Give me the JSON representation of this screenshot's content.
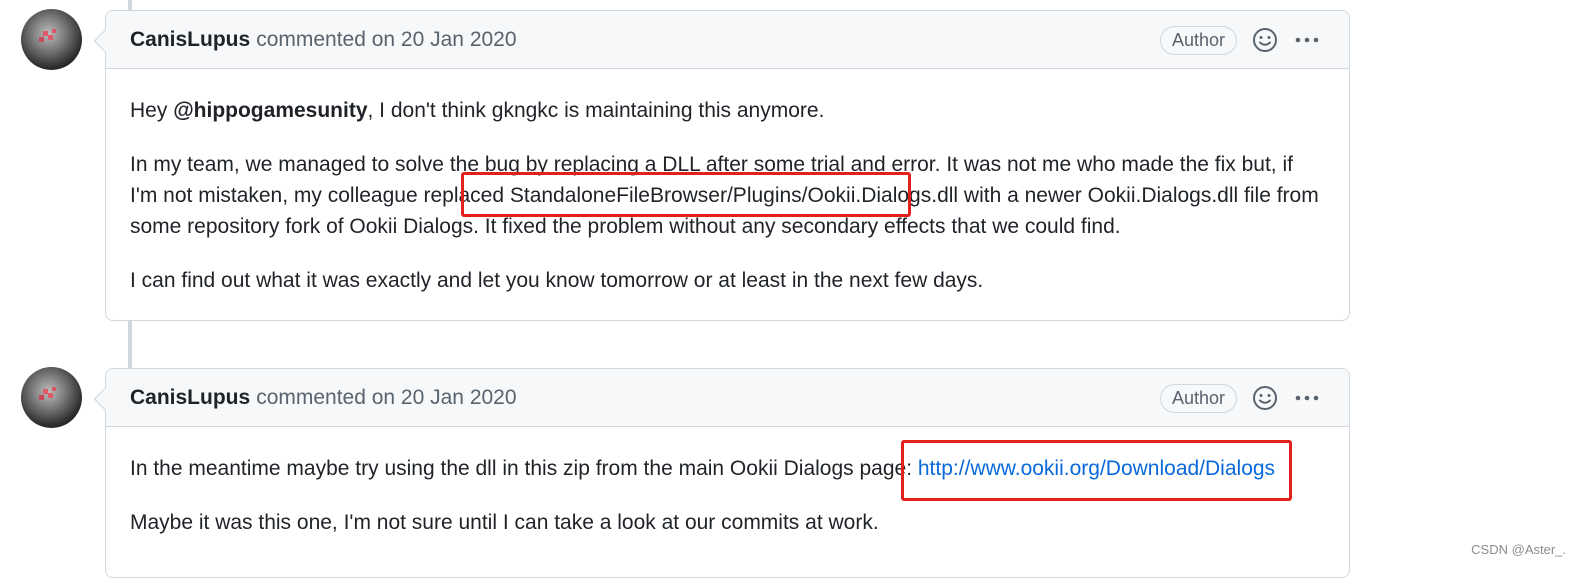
{
  "comments": [
    {
      "author": "CanisLupus",
      "meta": "commented on 20 Jan 2020",
      "badge": "Author",
      "p1": {
        "pre": "Hey ",
        "mention": "@hippogamesunity",
        "post": ", I don't think gkngkc is maintaining this anymore."
      },
      "p2": {
        "pre": "In my team, we managed to solve the bug by replacing a DLL after some trial and error. It was not me who made the fix but, if I'm not mistaken, my colleague replaced ",
        "code": "StandaloneFileBrowser/Plugins/Ookii.Dialogs.dll",
        "post": " with a newer Ookii.Dialogs.dll file from some repository fork of Ookii Dialogs. It fixed the problem without any secondary effects that we could find."
      },
      "p3": "I can find out what it was exactly and let you know tomorrow or at least in the next few days."
    },
    {
      "author": "CanisLupus",
      "meta": "commented on 20 Jan 2020",
      "badge": "Author",
      "p1": {
        "pre": "In the meantime maybe try using the dll in this zip from the main Ookii Dialogs page: ",
        "link": "http://www.ookii.org/Download/Dialogs"
      },
      "p2": "Maybe it was this one, I'm not sure until I can take a look at our commits at work."
    }
  ],
  "icons": {
    "reaction": "smiley-icon",
    "more": "kebab-horizontal-icon"
  },
  "colors": {
    "highlight": "#e3201b",
    "link": "#0969da",
    "border": "#d0d7de"
  },
  "watermark": "CSDN @Aster_."
}
